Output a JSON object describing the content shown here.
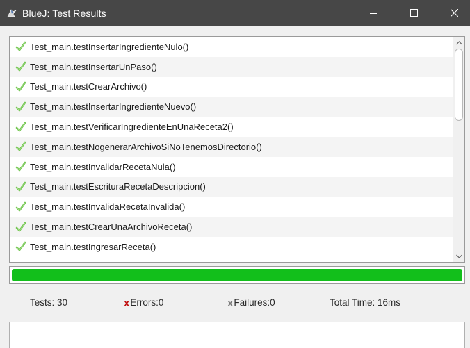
{
  "window": {
    "title": "BlueJ:  Test Results"
  },
  "tests": [
    {
      "name": "Test_main.testInsertarIngredienteNulo()"
    },
    {
      "name": "Test_main.testInsertarUnPaso()"
    },
    {
      "name": "Test_main.testCrearArchivo()"
    },
    {
      "name": "Test_main.testInsertarIngredienteNuevo()"
    },
    {
      "name": "Test_main.testVerificarIngredienteEnUnaReceta2()"
    },
    {
      "name": "Test_main.testNogenerarArchivoSiNoTenemosDirectorio()"
    },
    {
      "name": "Test_main.testInvalidarRecetaNula()"
    },
    {
      "name": "Test_main.testEscrituraRecetaDescripcion()"
    },
    {
      "name": "Test_main.testInvalidaRecetaInvalida()"
    },
    {
      "name": "Test_main.testCrearUnaArchivoReceta()"
    },
    {
      "name": "Test_main.testIngresarReceta()"
    }
  ],
  "progress": {
    "fraction": 1.0,
    "color": "#12bf1b"
  },
  "status": {
    "tests_label": "Tests:  30",
    "errors_mark": "x",
    "errors_label": "Errors:0",
    "failures_mark": "x",
    "failures_label": "Failures:0",
    "time_label": "Total Time:  16ms"
  },
  "colors": {
    "titlebar": "#474747",
    "pass_check": "#6cc24a",
    "error_mark": "#c01010",
    "failure_mark": "#7a7a7a"
  },
  "icons": {
    "app": "bluej-bird-icon",
    "pass": "check-icon",
    "minimize": "minimize-icon",
    "maximize": "maximize-icon",
    "close": "close-icon"
  }
}
